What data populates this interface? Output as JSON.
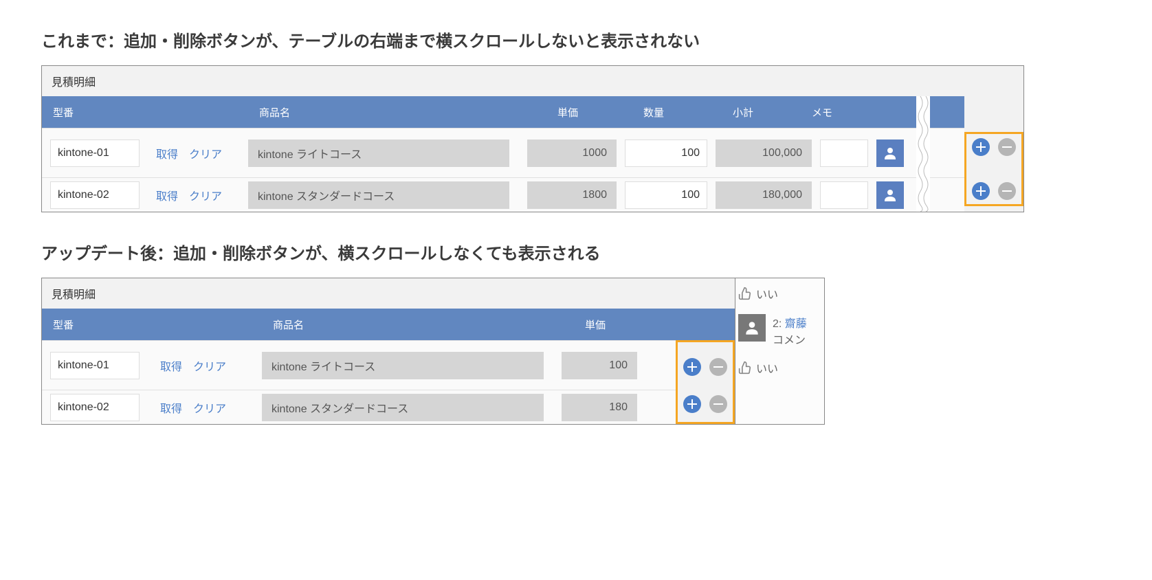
{
  "section1": {
    "title": "これまで：追加・削除ボタンが、テーブルの右端まで横スクロールしないと表示されない",
    "table_label": "見積明細",
    "headers": {
      "model": "型番",
      "name": "商品名",
      "price": "単価",
      "qty": "数量",
      "subtotal": "小計",
      "memo": "メモ"
    },
    "links": {
      "get": "取得",
      "clear": "クリア"
    },
    "rows": [
      {
        "model": "kintone-01",
        "name": "kintone ライトコース",
        "price": "1000",
        "qty": "100",
        "subtotal": "100,000"
      },
      {
        "model": "kintone-02",
        "name": "kintone スタンダードコース",
        "price": "1800",
        "qty": "100",
        "subtotal": "180,000"
      }
    ]
  },
  "section2": {
    "title": "アップデート後：追加・削除ボタンが、横スクロールしなくても表示される",
    "table_label": "見積明細",
    "headers": {
      "model": "型番",
      "name": "商品名",
      "price": "単価"
    },
    "links": {
      "get": "取得",
      "clear": "クリア"
    },
    "rows": [
      {
        "model": "kintone-01",
        "name": "kintone ライトコース",
        "price": "100"
      },
      {
        "model": "kintone-02",
        "name": "kintone スタンダードコース",
        "price": "180"
      }
    ],
    "side": {
      "like": "いい",
      "comment_index": "2:",
      "comment_user": "齋藤",
      "comment_text": "コメン",
      "like2": "いい"
    }
  }
}
